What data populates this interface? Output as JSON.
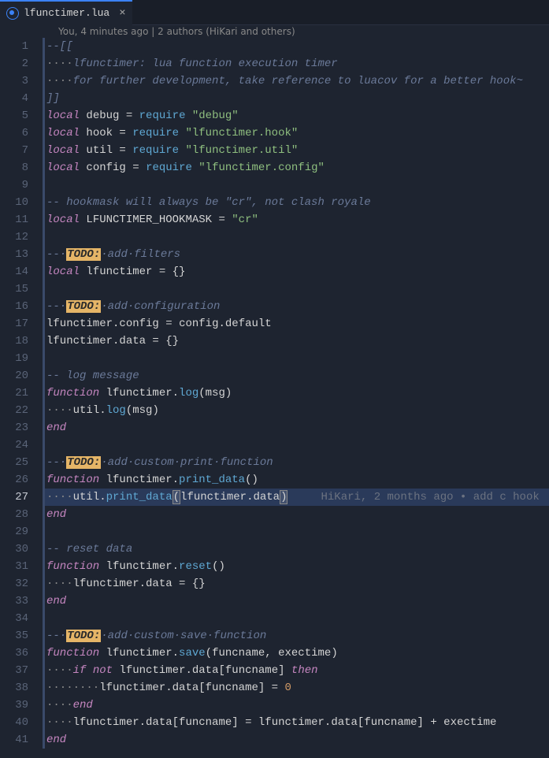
{
  "tab": {
    "filename": "lfunctimer.lua",
    "close": "×"
  },
  "blameBar": "You, 4 minutes ago | 2 authors (HiKari and others)",
  "lineCount": 41,
  "inlineBlame": "HiKari, 2 months ago • add c hook",
  "code": {
    "l1": "--[[",
    "l2a": "····",
    "l2b": "lfunctimer: lua function execution timer",
    "l3a": "····",
    "l3b": "for further development, take reference to luacov for a better hook~",
    "l4": "]]",
    "l5_local": "local",
    "l5_debug": "debug",
    "l5_eq": " = ",
    "l5_req": "require",
    "l5_sp": " ",
    "l5_str": "\"debug\"",
    "l6_local": "local",
    "l6_v": "hook",
    "l6_eq": " = ",
    "l6_req": "require",
    "l6_sp": " ",
    "l6_str": "\"lfunctimer.hook\"",
    "l7_local": "local",
    "l7_v": "util",
    "l7_eq": " = ",
    "l7_req": "require",
    "l7_sp": " ",
    "l7_str": "\"lfunctimer.util\"",
    "l8_local": "local",
    "l8_v": "config",
    "l8_eq": " = ",
    "l8_req": "require",
    "l8_sp": " ",
    "l8_str": "\"lfunctimer.config\"",
    "l10": "-- hookmask will always be \"cr\", not clash royale",
    "l11_local": "local",
    "l11_v": "LFUNCTIMER_HOOKMASK",
    "l11_eq": " = ",
    "l11_str": "\"cr\"",
    "l13_pre": "--·",
    "l13_todo": "TODO:",
    "l13_rest": "·add·filters",
    "l14_local": "local",
    "l14_v": "lfunctimer",
    "l14_eq": " = ",
    "l14_br": "{}",
    "l16_pre": "--·",
    "l16_todo": "TODO:",
    "l16_rest": "·add·configuration",
    "l17_a": "lfunctimer",
    "l17_b": ".",
    "l17_c": "config",
    "l17_d": " = ",
    "l17_e": "config",
    "l17_f": ".",
    "l17_g": "default",
    "l18_a": "lfunctimer",
    "l18_b": ".",
    "l18_c": "data",
    "l18_d": " = ",
    "l18_e": "{}",
    "l20": "-- log message",
    "l21_fn": "function",
    "l21_a": " lfunctimer",
    "l21_b": ".",
    "l21_c": "log",
    "l21_d": "(",
    "l21_e": "msg",
    "l21_f": ")",
    "l22_ws": "····",
    "l22_a": "util",
    "l22_b": ".",
    "l22_c": "log",
    "l22_d": "(",
    "l22_e": "msg",
    "l22_f": ")",
    "l23": "end",
    "l25_pre": "--·",
    "l25_todo": "TODO:",
    "l25_rest": "·add·custom·print·function",
    "l26_fn": "function",
    "l26_a": " lfunctimer",
    "l26_b": ".",
    "l26_c": "print_data",
    "l26_d": "(",
    "l26_e": ")",
    "l27_ws": "····",
    "l27_a": "util",
    "l27_b": ".",
    "l27_c": "print_data",
    "l27_d": "(",
    "l27_e": "lfunctimer",
    "l27_f": ".",
    "l27_g": "data",
    "l27_h": ")",
    "l28": "end",
    "l30": "-- reset data",
    "l31_fn": "function",
    "l31_a": " lfunctimer",
    "l31_b": ".",
    "l31_c": "reset",
    "l31_d": "(",
    "l31_e": ")",
    "l32_ws": "····",
    "l32_a": "lfunctimer",
    "l32_b": ".",
    "l32_c": "data",
    "l32_d": " = ",
    "l32_e": "{}",
    "l33": "end",
    "l35_pre": "--·",
    "l35_todo": "TODO:",
    "l35_rest": "·add·custom·save·function",
    "l36_fn": "function",
    "l36_a": " lfunctimer",
    "l36_b": ".",
    "l36_c": "save",
    "l36_d": "(",
    "l36_e": "funcname",
    "l36_f": ", ",
    "l36_g": "exectime",
    "l36_h": ")",
    "l37_ws": "····",
    "l37_if": "if",
    "l37_sp1": " ",
    "l37_not": "not",
    "l37_sp2": " ",
    "l37_a": "lfunctimer",
    "l37_b": ".",
    "l37_c": "data",
    "l37_d": "[",
    "l37_e": "funcname",
    "l37_f": "]",
    "l37_sp3": " ",
    "l37_then": "then",
    "l38_ws": "········",
    "l38_a": "lfunctimer",
    "l38_b": ".",
    "l38_c": "data",
    "l38_d": "[",
    "l38_e": "funcname",
    "l38_f": "]",
    "l38_g": " = ",
    "l38_h": "0",
    "l39_ws": "····",
    "l39": "end",
    "l40_ws": "····",
    "l40_a": "lfunctimer",
    "l40_b": ".",
    "l40_c": "data",
    "l40_d": "[",
    "l40_e": "funcname",
    "l40_f": "]",
    "l40_g": " = ",
    "l40_h": "lfunctimer",
    "l40_i": ".",
    "l40_j": "data",
    "l40_k": "[",
    "l40_l": "funcname",
    "l40_m": "]",
    "l40_n": " + ",
    "l40_o": "exectime",
    "l41": "end"
  }
}
